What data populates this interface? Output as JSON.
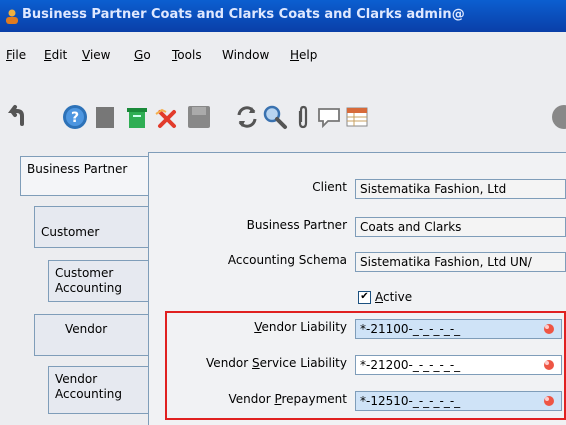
{
  "window": {
    "title": "Business Partner  Coats and Clarks  Coats and Clarks  admin@"
  },
  "menu": [
    {
      "label": "File",
      "u": "F"
    },
    {
      "label": "Edit",
      "u": "E"
    },
    {
      "label": "View",
      "u": "V"
    },
    {
      "label": "Go",
      "u": "G"
    },
    {
      "label": "Tools",
      "u": "T"
    },
    {
      "label": "Window",
      "u": ""
    },
    {
      "label": "Help",
      "u": "H"
    }
  ],
  "toolbar": [
    "undo-icon",
    "help-icon",
    "new-record-icon",
    "delete-icon",
    "delete-selection-icon",
    "save-icon",
    "refresh-icon",
    "find-icon",
    "attachment-icon",
    "chat-icon",
    "grid-toggle-icon",
    "more-icon"
  ],
  "tabs": [
    {
      "label": "Business Partner"
    },
    {
      "label": "Customer"
    },
    {
      "label": "Customer Accounting"
    },
    {
      "label": "Vendor"
    },
    {
      "label": "Vendor Accounting"
    }
  ],
  "form": {
    "client_label": "Client",
    "client_value": "Sistematika Fashion, Ltd",
    "bp_label": "Business Partner",
    "bp_value": "Coats and Clarks",
    "schema_label": "Accounting Schema",
    "schema_value": "Sistematika Fashion, Ltd UN/",
    "active_label": "Active",
    "active_checked": true,
    "vendor_liability_label": "Vendor Liability",
    "vendor_liability_value": "*-21100-_-_-_-_-_",
    "vendor_service_liability_label": "Vendor Service Liability",
    "vendor_service_liability_value": "*-21200-_-_-_-_-_",
    "vendor_prepayment_label": "Vendor Prepayment",
    "vendor_prepayment_value": "*-12510-_-_-_-_-_"
  }
}
